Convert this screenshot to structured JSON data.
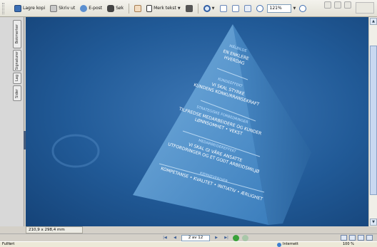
{
  "toolbar": {
    "save_copy": "Lagre kopi",
    "print": "Skriv ut",
    "email": "E-post",
    "search": "Søk",
    "select_text": "Merk tekst",
    "zoom_value": "121%"
  },
  "left_tabs": [
    "Bokmerker",
    "Signaturer",
    "Lag",
    "Sider"
  ],
  "pyramid": {
    "tiers": [
      {
        "heading": "MÅLBILDE",
        "lines": [
          "EN ENKLERE",
          "HVERDAG"
        ]
      },
      {
        "heading": "KUNDEEFFEKT",
        "lines": [
          "VI SKAL STYRKE",
          "KUNDENS KONKURRANSEKRAFT"
        ]
      },
      {
        "heading": "STRATEGISKE FORBEDRINGER",
        "lines": [
          "TILFREDSE MEDARBEIDERE OG KUNDER",
          "LØNNSOMHET • VEKST"
        ]
      },
      {
        "heading": "MEDARBEIDEREFFEKT",
        "lines": [
          "VI SKAL GI VÅRE ANSATTE",
          "UTFORDRINGER OG ET GODT ARBEIDSMILJØ"
        ]
      },
      {
        "heading": "KJERNEVERDIER",
        "lines": [
          "KOMPETANSE • KVALITET • INITIATIV • ÆRLIGHET"
        ]
      }
    ]
  },
  "page_size": "210,9 x 298,4 mm",
  "navigation": {
    "page_indicator": "2 av 12"
  },
  "status": {
    "left": "Fullført",
    "zone": "Internett",
    "zoom": "100 %"
  },
  "colors": {
    "canvas": "#215a97",
    "pyramid_face": "#5f9fd2"
  }
}
